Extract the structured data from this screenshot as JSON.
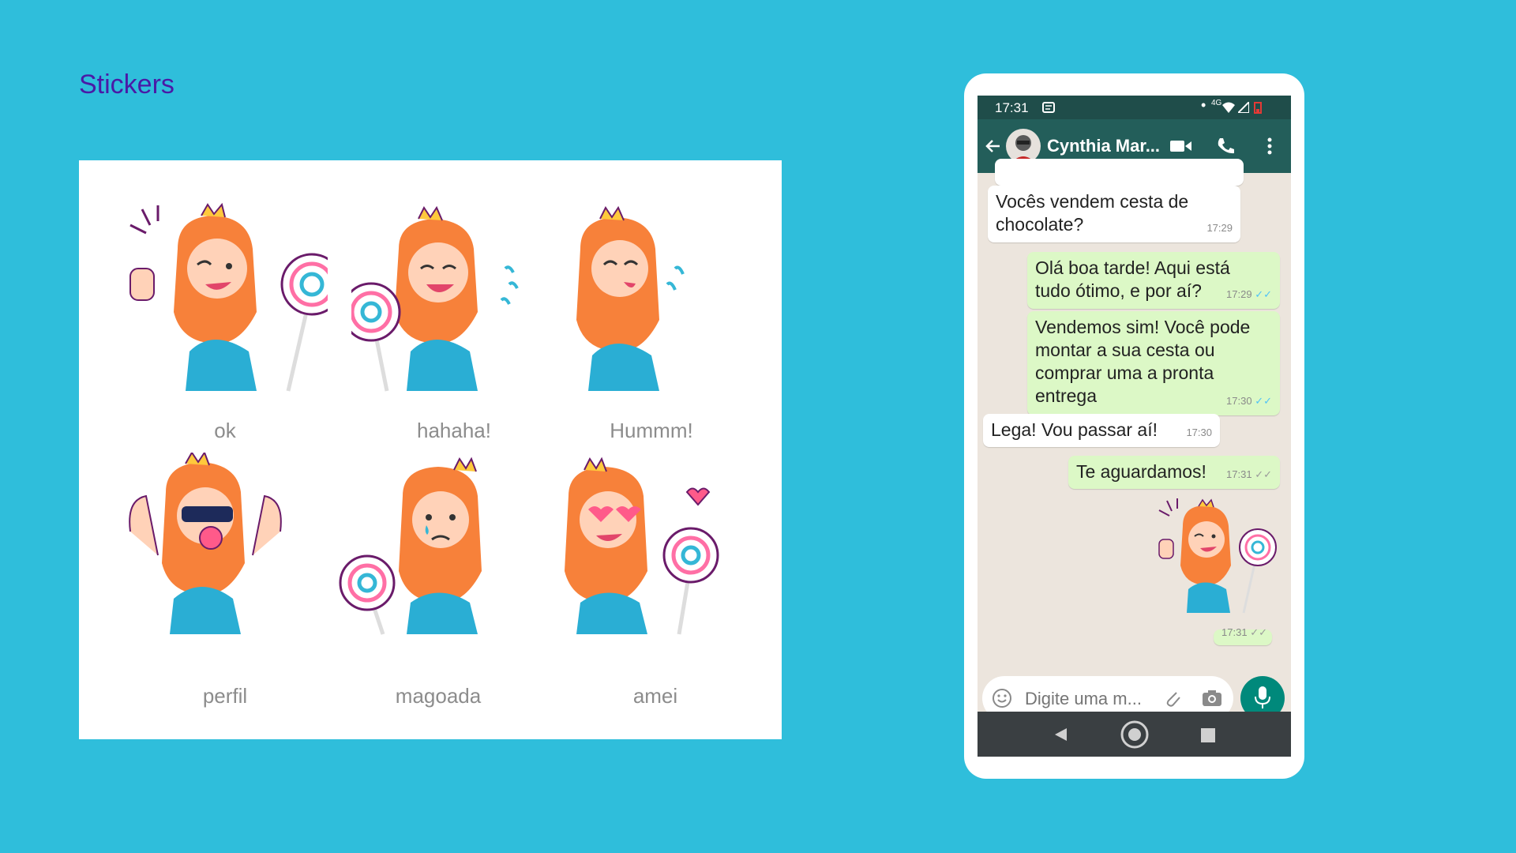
{
  "page": {
    "title": "Stickers"
  },
  "stickers": [
    {
      "label": "ok"
    },
    {
      "label": "hahaha!"
    },
    {
      "label": "Hummm!"
    },
    {
      "label": "perfil"
    },
    {
      "label": "magoada"
    },
    {
      "label": "amei"
    }
  ],
  "phone": {
    "status": {
      "time": "17:31",
      "network": "4G"
    },
    "contact": {
      "name": "Cynthia Mar..."
    },
    "messages": [
      {
        "dir": "in",
        "text_lines": [
          "Vocês vendem cesta de",
          "chocolate?"
        ],
        "time": "17:29"
      },
      {
        "dir": "out",
        "text_lines": [
          "Olá boa tarde! Aqui está",
          "tudo ótimo, e por aí?"
        ],
        "time": "17:29",
        "read": true
      },
      {
        "dir": "out",
        "text_lines": [
          "Vendemos sim! Você pode",
          "montar a sua cesta ou",
          "comprar uma a pronta",
          "entrega"
        ],
        "time": "17:30",
        "read": true
      },
      {
        "dir": "in",
        "text_lines": [
          "Lega! Vou passar aí!"
        ],
        "time": "17:30"
      },
      {
        "dir": "out",
        "text_lines": [
          "Te aguardamos!"
        ],
        "time": "17:31",
        "read": false
      },
      {
        "dir": "out",
        "type": "sticker",
        "sticker": "ok",
        "time": "17:31",
        "read": false
      }
    ],
    "input": {
      "placeholder": "Digite uma m..."
    },
    "icons": {
      "back": "arrow-left-icon",
      "video": "video-camera-icon",
      "call": "phone-icon",
      "menu": "more-vert-icon",
      "emoji": "emoji-icon",
      "attach": "paperclip-icon",
      "camera": "camera-icon",
      "mic": "microphone-icon"
    }
  },
  "colors": {
    "background": "#2fbedb",
    "title": "#4a1aa6",
    "app_bar": "#235e5a",
    "outgoing_bubble": "#dcf8c6",
    "mic_button": "#00897b"
  }
}
